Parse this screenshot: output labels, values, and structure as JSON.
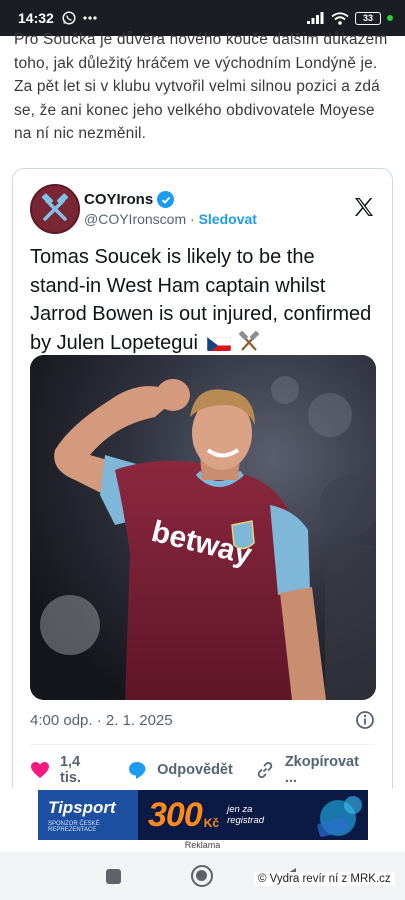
{
  "status_bar": {
    "time": "14:32",
    "battery": "33"
  },
  "article": {
    "paragraph": "Pro Součka je důvěra nového kouče dalším důkazem toho, jak důležitý hráčem ve východním Londýně je. Za pět let si v klubu vytvořil velmi silnou pozici a zdá se, že ani konec jeho velkého obdivovatele Moyese na ní nic nezměnil."
  },
  "tweet": {
    "display_name": "COYIrons",
    "handle": "@COYIronscom",
    "separator": "·",
    "follow_label": "Sledovat",
    "text": "Tomas Soucek is likely to be the stand-in West Ham captain whilst Jarrod Bowen is out injured, confirmed by Julen Lopetegui",
    "timestamp": "4:00 odp. · 2. 1. 2025",
    "jersey_sponsor": "betway",
    "actions": {
      "likes": "1,4 tis.",
      "reply": "Odpovědět",
      "copy": "Zkopírovat ..."
    },
    "icons": [
      "verified-icon",
      "x-logo-icon",
      "czech-flag-icon",
      "hammers-icon",
      "info-icon",
      "heart-icon",
      "reply-icon",
      "link-icon"
    ]
  },
  "ad": {
    "brand": "Tipsport",
    "brand_sub": "SPONZOR ČESKÉ REPREZENTACE",
    "amount": "300",
    "currency": "Kč",
    "promo_line1": "jen za",
    "promo_line2": "registrad",
    "label": "Reklama"
  },
  "watermark": "© Vydra revír ní z MRK.cz",
  "colors": {
    "accent": "#1d9bf0",
    "like": "#f91880",
    "ad_orange": "#ff8a1c"
  }
}
